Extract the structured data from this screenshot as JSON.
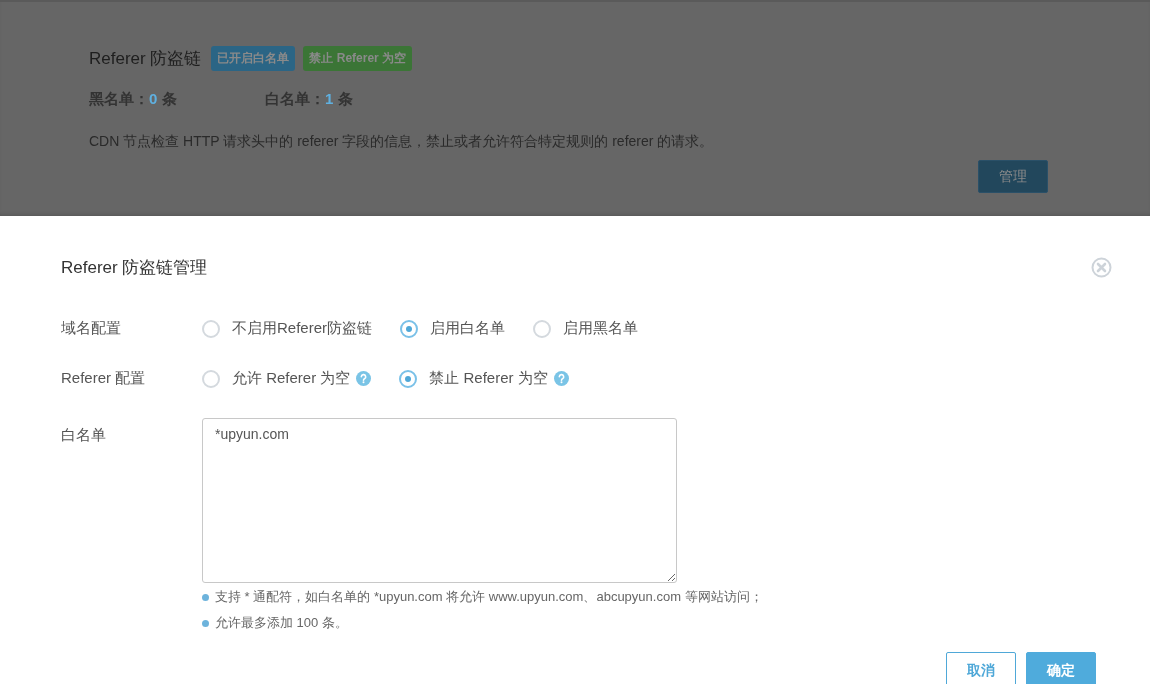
{
  "background_panel": {
    "title": "Referer 防盗链",
    "badges": [
      {
        "label": "已开启白名单",
        "color": "#2b6585"
      },
      {
        "label": "禁止 Referer 为空",
        "color": "#3b7536"
      }
    ],
    "counts": [
      {
        "label": "黑名单：",
        "value": "0",
        "unit": "条"
      },
      {
        "label": "白名单：",
        "value": "1",
        "unit": "条"
      }
    ],
    "description": "CDN 节点检查 HTTP 请求头中的 referer 字段的信息，禁止或者允许符合特定规则的 referer 的请求。",
    "button": "管理"
  },
  "dialog": {
    "title": "Referer 防盗链管理",
    "rows": [
      {
        "kind": "radio",
        "label": "域名配置",
        "options": [
          {
            "label": "不启用Referer防盗链",
            "selected": false,
            "help": false
          },
          {
            "label": "启用白名单",
            "selected": true,
            "help": false
          },
          {
            "label": "启用黑名单",
            "selected": false,
            "help": false
          }
        ]
      },
      {
        "kind": "radio",
        "label": "Referer 配置",
        "options": [
          {
            "label": "允许 Referer 为空",
            "selected": false,
            "help": true
          },
          {
            "label": "禁止 Referer 为空",
            "selected": true,
            "help": true
          }
        ]
      },
      {
        "kind": "textarea",
        "label": "白名单",
        "value": "*upyun.com"
      }
    ],
    "notes": [
      "支持 * 通配符，如白名单的 *upyun.com 将允许 www.upyun.com、abcupyun.com 等网站访问；",
      "允许最多添加 100 条。"
    ],
    "buttons": [
      {
        "label": "取消",
        "kind": "secondary"
      },
      {
        "label": "确定",
        "kind": "primary"
      }
    ]
  }
}
